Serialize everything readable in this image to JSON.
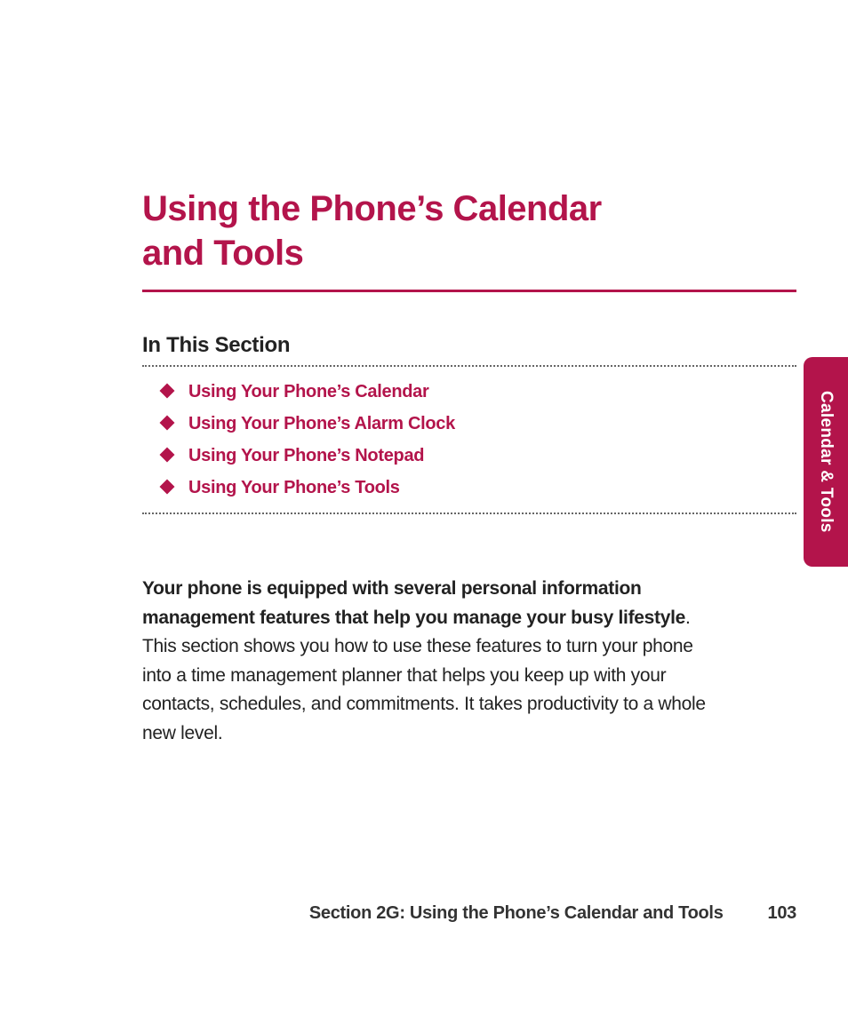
{
  "title_line1": "Using the Phone’s Calendar",
  "title_line2": "and Tools",
  "subhead": "In This Section",
  "toc": {
    "items": [
      {
        "label": "Using Your Phone’s Calendar"
      },
      {
        "label": "Using Your Phone’s Alarm Clock"
      },
      {
        "label": "Using Your Phone’s Notepad"
      },
      {
        "label": "Using Your Phone’s Tools"
      }
    ]
  },
  "intro": {
    "lead": "Your phone is equipped with several personal information management features that help you manage your busy lifestyle",
    "rest": ". This section shows you how to use these features to turn your phone into a time management planner that helps you keep up with your contacts, schedules, and commitments. It takes productivity to a whole new level."
  },
  "side_tab": "Calendar & Tools",
  "footer": {
    "label": "Section 2G: Using the Phone’s Calendar and Tools",
    "page": "103"
  },
  "colors": {
    "accent": "#b3144b"
  }
}
